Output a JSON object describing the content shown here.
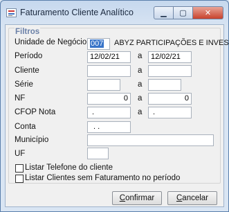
{
  "window": {
    "title": "Faturamento Cliente Analítico",
    "btn_min": "▁",
    "btn_max": "▢",
    "btn_close": "✕"
  },
  "group": {
    "title": "Filtros"
  },
  "fields": {
    "unidade_label": "Unidade de Negócio",
    "unidade_code": "007",
    "unidade_name": "ABYZ PARTICIPAÇÕES E INVES",
    "periodo_label": "Período",
    "periodo_de": "12/02/21",
    "periodo_ate": "12/02/21",
    "cliente_label": "Cliente",
    "cliente_de": "",
    "cliente_ate": "",
    "serie_label": "Série",
    "serie_de": "",
    "serie_ate": "",
    "nf_label": "NF",
    "nf_de": "0",
    "nf_ate": "0",
    "cfop_label": "CFOP Nota",
    "cfop_de": ".",
    "cfop_ate": ".",
    "conta_label": "Conta",
    "conta_value": ". .",
    "municipio_label": "Município",
    "municipio_value": "",
    "uf_label": "UF",
    "uf_value": "",
    "a_label": "a"
  },
  "checkboxes": {
    "telefone_label": "Listar Telefone do cliente",
    "telefone_checked": false,
    "sem_fat_label": "Listar Clientes sem Faturamento no período",
    "sem_fat_checked": false
  },
  "buttons": {
    "confirmar_prefix": "C",
    "confirmar_rest": "onfirmar",
    "cancelar_prefix": "C",
    "cancelar_rest": "ancelar"
  }
}
